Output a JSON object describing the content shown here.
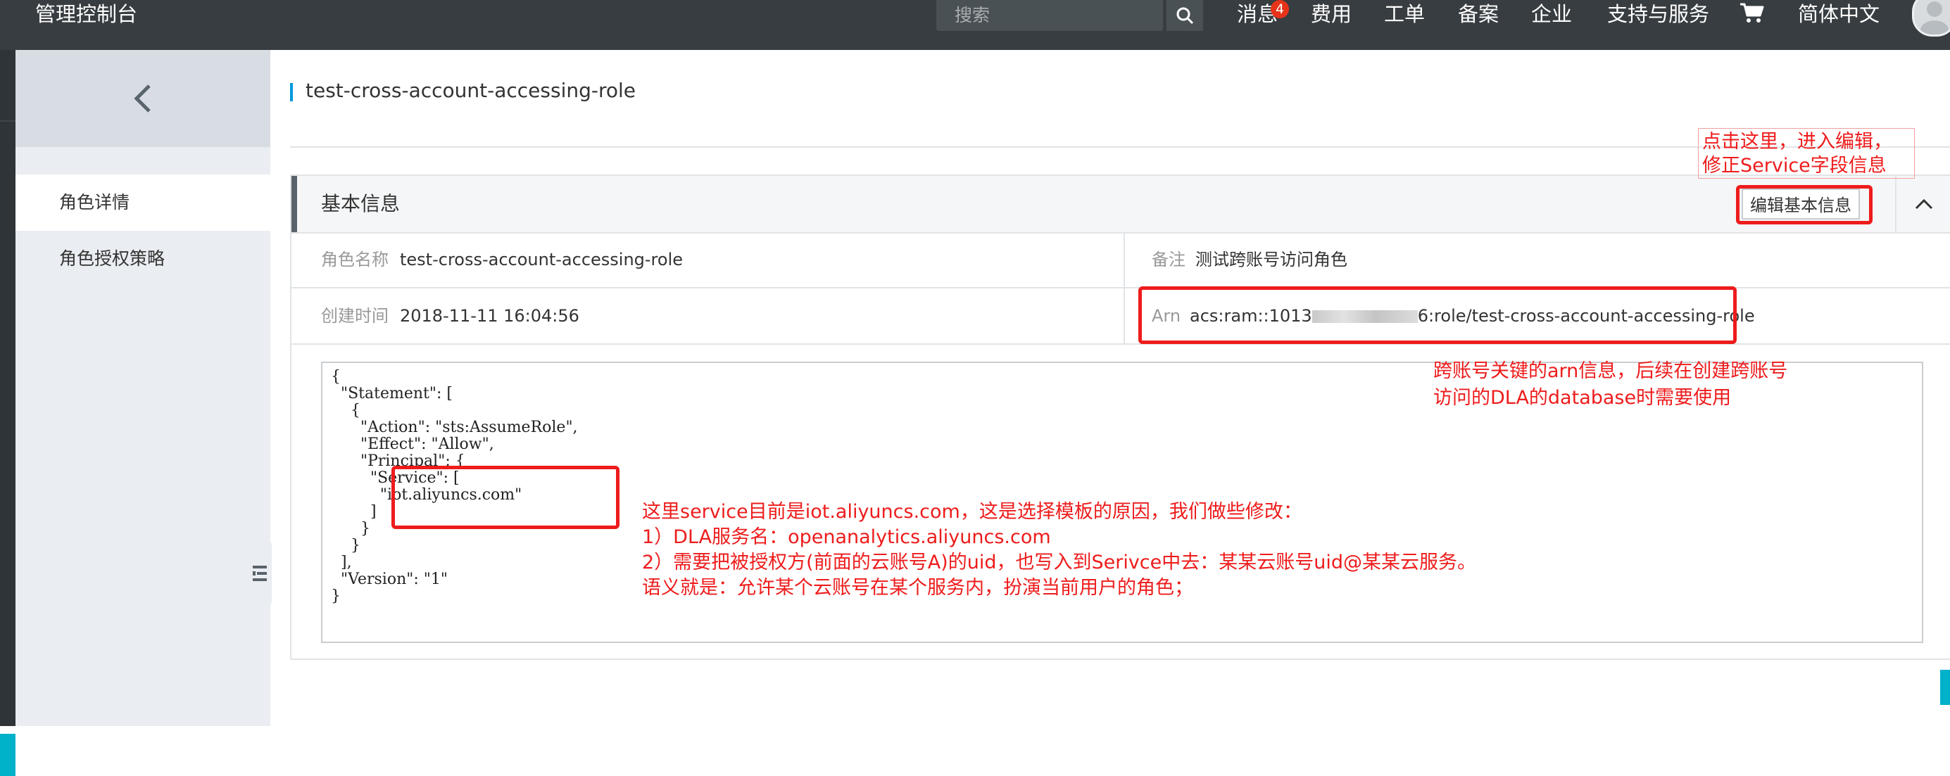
{
  "topbar": {
    "brand": "管理控制台",
    "search_placeholder": "搜索",
    "messages_label": "消息",
    "messages_count": "4",
    "billing": "费用",
    "tickets": "工单",
    "icp": "备案",
    "enterprise": "企业",
    "support": "支持与服务",
    "language": "简体中文",
    "icons": [
      "search-icon",
      "cart-icon",
      "avatar"
    ]
  },
  "sidebar": {
    "items": [
      {
        "label": "角色详情",
        "active": true
      },
      {
        "label": "角色授权策略",
        "active": false
      }
    ]
  },
  "page": {
    "title": "test-cross-account-accessing-role"
  },
  "basic_info": {
    "title": "基本信息",
    "edit_button": "编辑基本信息",
    "role_name_label": "角色名称",
    "role_name": "test-cross-account-accessing-role",
    "remark_label": "备注",
    "remark": "测试跨账号访问角色",
    "created_label": "创建时间",
    "created": "2018-11-11 16:04:56",
    "arn_label": "Arn",
    "arn_prefix": "acs:ram::1013",
    "arn_suffix": "6:role/test-cross-account-accessing-role",
    "policy_json": "{\n  \"Statement\": [\n    {\n      \"Action\": \"sts:AssumeRole\",\n      \"Effect\": \"Allow\",\n      \"Principal\": {\n        \"Service\": [\n          \"iot.aliyuncs.com\"\n        ]\n      }\n    }\n  ],\n  \"Version\": \"1\"\n}"
  },
  "annotations": {
    "edit_note_line1": "点击这里，进入编辑，",
    "edit_note_line2": "修正Service字段信息",
    "arn_note_line1": "跨账号关键的arn信息，后续在创建跨账号",
    "arn_note_line2": "访问的DLA的database时需要使用",
    "service_note_line1": "这里service目前是iot.aliyuncs.com，这是选择模板的原因，我们做些修改：",
    "service_note_line2": "1）DLA服务名：openanalytics.aliyuncs.com",
    "service_note_line3": "2）需要把被授权方(前面的云账号A)的uid，也写入到Serivce中去：某某云账号uid@某某云服务。",
    "service_note_line4": "语义就是：允许某个云账号在某个服务内，扮演当前用户的角色；",
    "color": "#ee1c1c"
  },
  "colors": {
    "topbar_bg": "#373d41",
    "sidebar_bg": "#eaedf1",
    "accent_blue": "#0099dd",
    "badge_red": "#e6331a"
  }
}
